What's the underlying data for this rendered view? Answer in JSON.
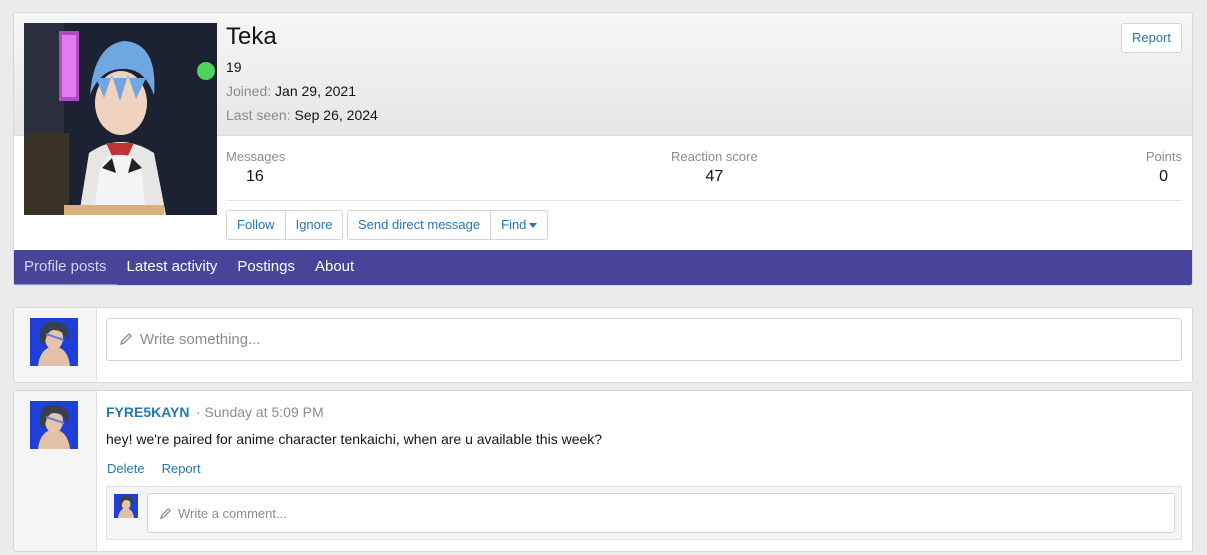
{
  "profile": {
    "username": "Teka",
    "user_title": "19",
    "joined_label": "Joined:",
    "joined_value": "Jan 29, 2021",
    "last_seen_label": "Last seen:",
    "last_seen_value": "Sep 26, 2024",
    "report_label": "Report"
  },
  "stats": {
    "messages_label": "Messages",
    "messages_value": "16",
    "reaction_label": "Reaction score",
    "reaction_value": "47",
    "points_label": "Points",
    "points_value": "0"
  },
  "actions": {
    "follow": "Follow",
    "ignore": "Ignore",
    "send_dm": "Send direct message",
    "find": "Find"
  },
  "tabs": [
    {
      "label": "Profile posts",
      "active": true
    },
    {
      "label": "Latest activity",
      "active": false
    },
    {
      "label": "Postings",
      "active": false
    },
    {
      "label": "About",
      "active": false
    }
  ],
  "compose": {
    "placeholder": "Write something..."
  },
  "post": {
    "author": "FYRE5KAYN",
    "time": "· Sunday at 5:09 PM",
    "text": "hey! we're paired for anime character tenkaichi, when are u available this week?",
    "delete_label": "Delete",
    "report_label": "Report",
    "comment_placeholder": "Write a comment..."
  },
  "colors": {
    "tab_bar": "#47459a",
    "link": "#2577b1"
  },
  "icons": {
    "pencil": "pencil-icon",
    "caret": "caret-down-icon"
  }
}
